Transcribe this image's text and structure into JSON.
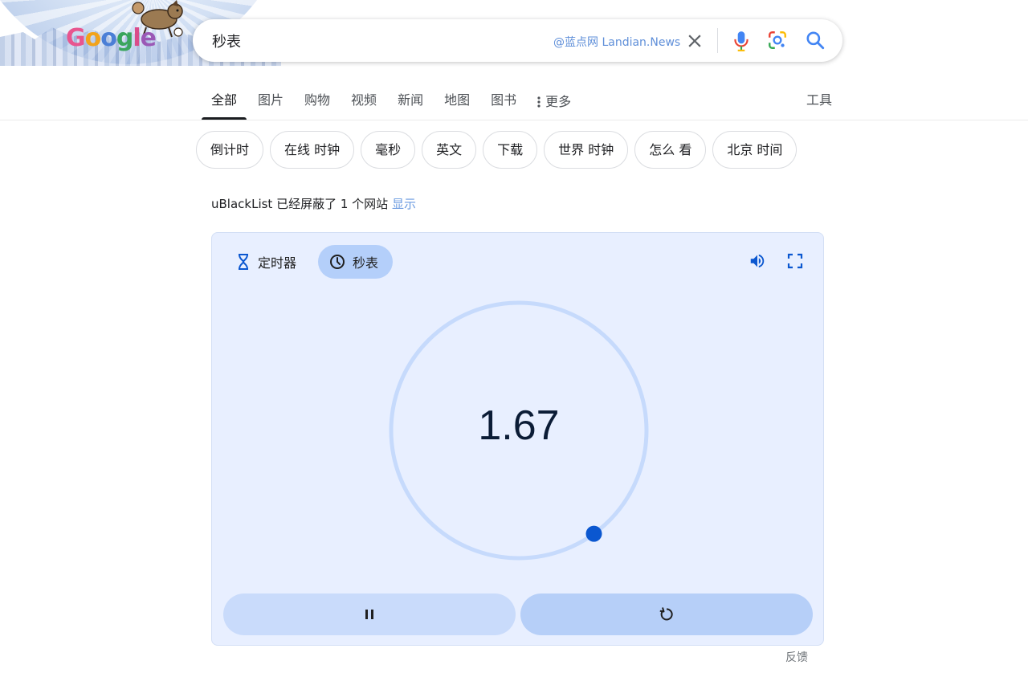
{
  "doodle": {
    "logo_text": "Google"
  },
  "search": {
    "query": "秒表",
    "watermark": "@蓝点网 Landian.News"
  },
  "icons": {
    "clear": "close-icon",
    "mic": "microphone-icon",
    "lens": "lens-icon",
    "search": "search-icon",
    "timer": "hourglass-icon",
    "stopwatch": "stopwatch-icon",
    "volume": "volume-icon",
    "fullscreen": "fullscreen-icon",
    "pause": "pause-icon",
    "reset": "reset-icon",
    "more": "more-vert-icon"
  },
  "tabs": [
    {
      "label": "全部",
      "active": true
    },
    {
      "label": "图片"
    },
    {
      "label": "购物"
    },
    {
      "label": "视频"
    },
    {
      "label": "新闻"
    },
    {
      "label": "地图"
    },
    {
      "label": "图书"
    },
    {
      "label": "更多"
    }
  ],
  "tools_label": "工具",
  "chips": [
    "倒计时",
    "在线 时钟",
    "毫秒",
    "英文",
    "下载",
    "世界 时钟",
    "怎么 看",
    "北京 时间"
  ],
  "notice": {
    "text": "uBlackList 已经屏蔽了 1 个网站",
    "link": "显示"
  },
  "stopwatch": {
    "mode_timer": "定时器",
    "mode_stopwatch": "秒表",
    "display": "1.67",
    "progress_fraction": 0.4,
    "colors": {
      "ring": "#c6dafc",
      "dot": "#0b57d0",
      "card": "#e8efff",
      "active_mode": "#b4cffa"
    }
  },
  "feedback": "反馈"
}
